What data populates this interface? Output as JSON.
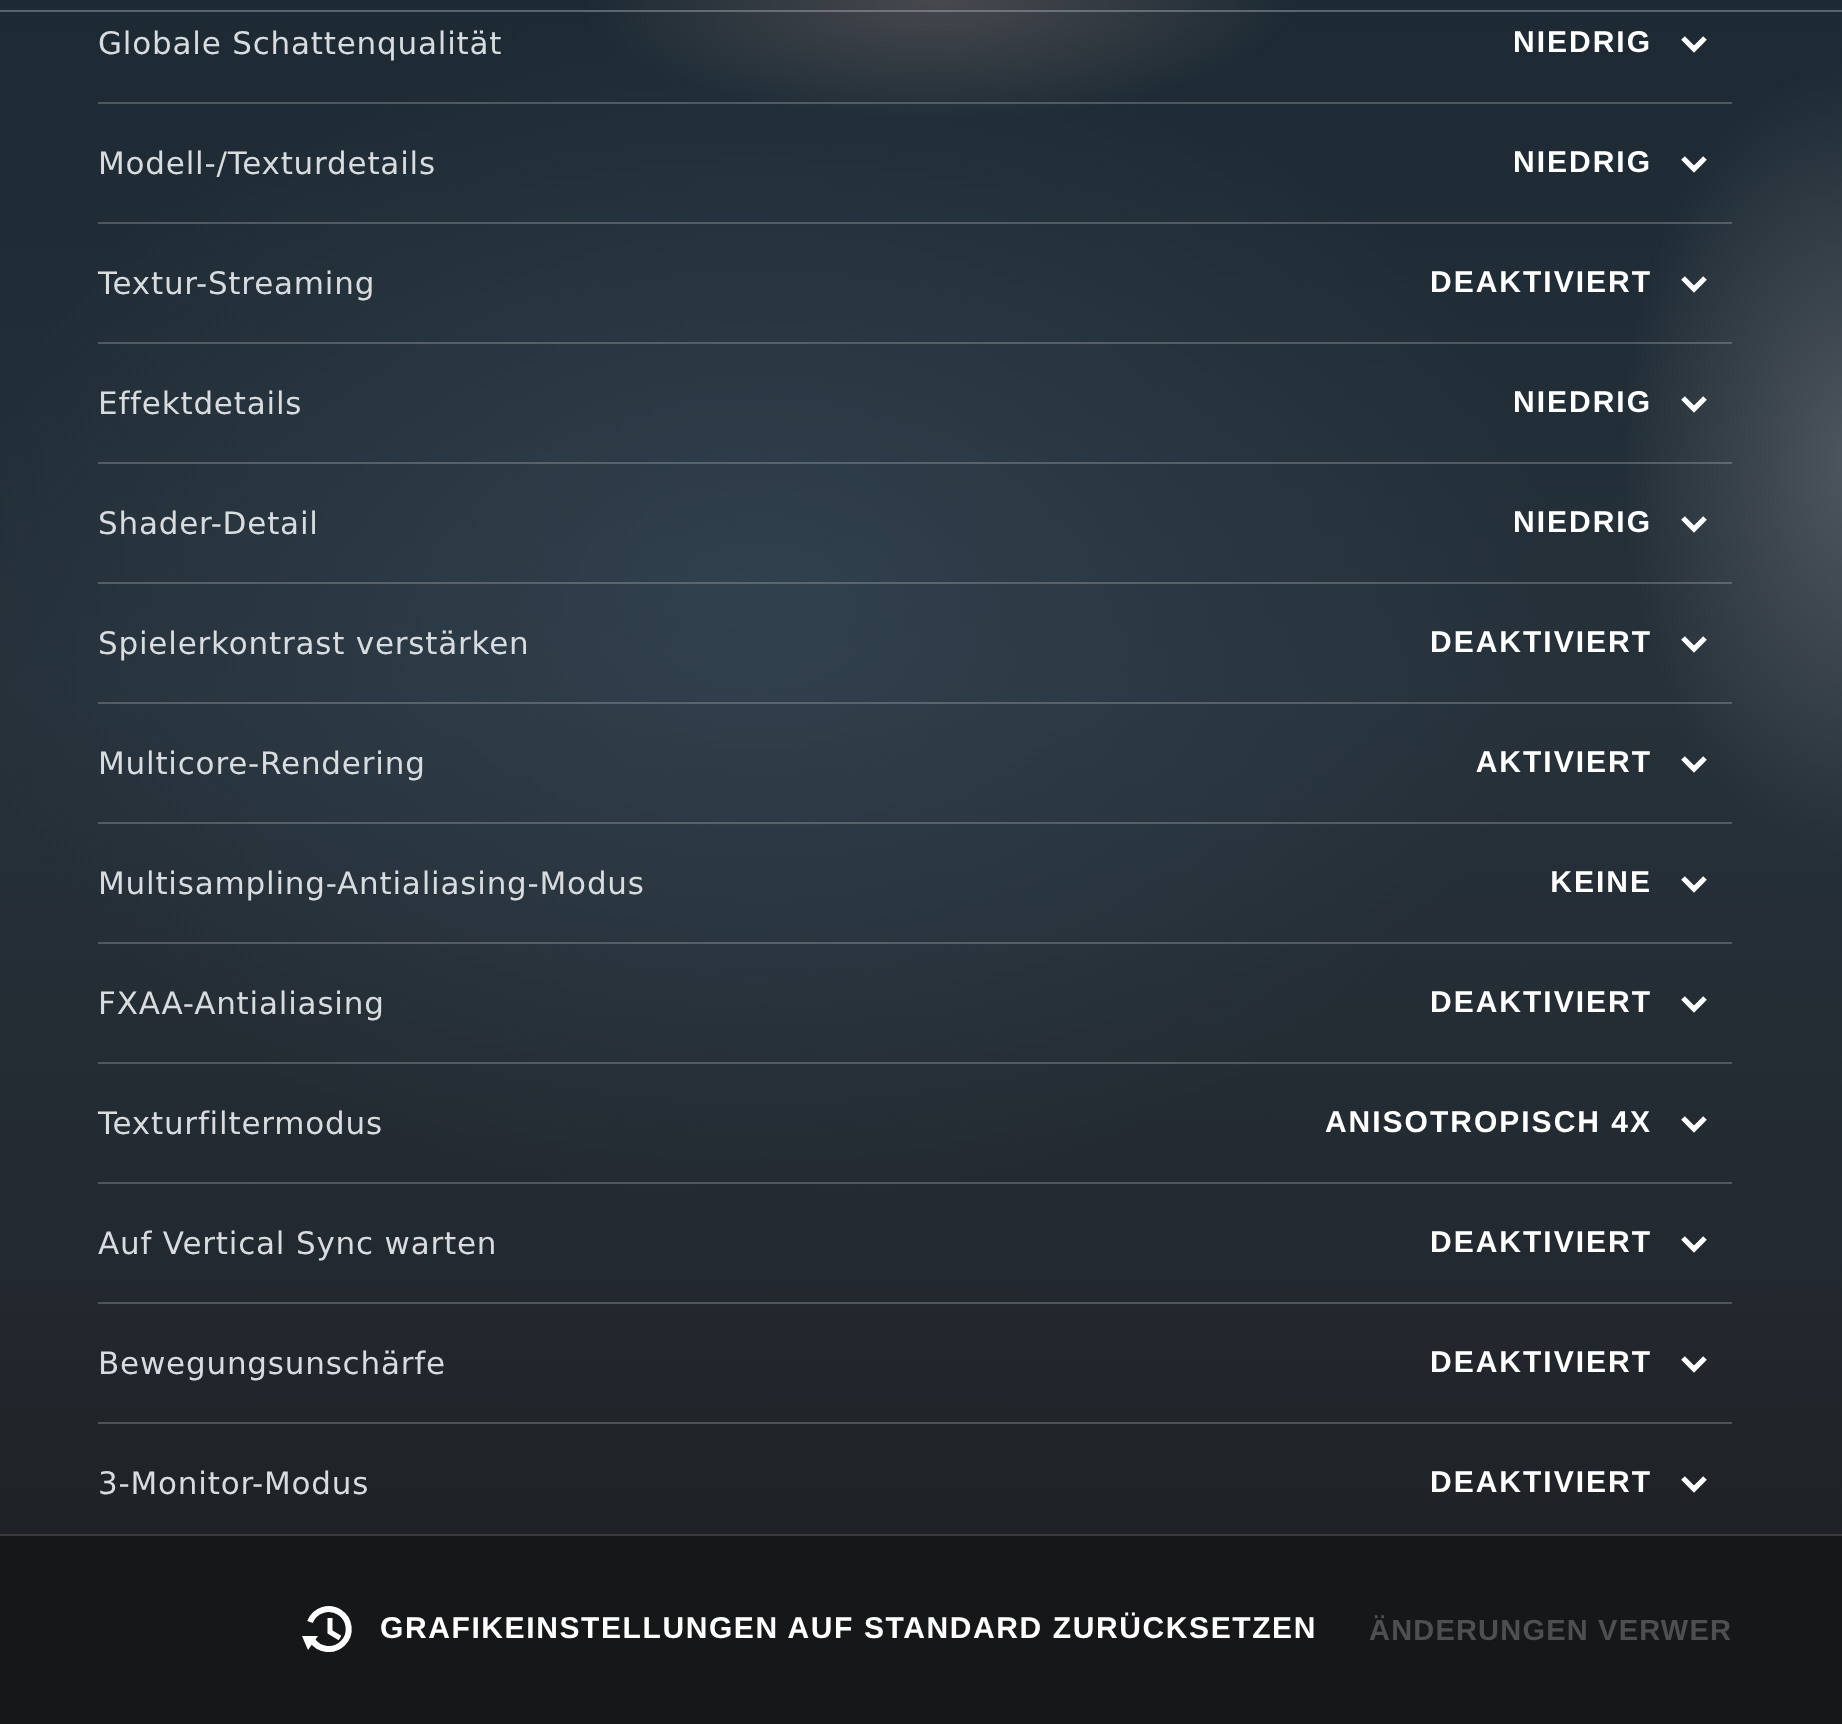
{
  "settings": [
    {
      "label": "Globale Schattenqualität",
      "value": "NIEDRIG"
    },
    {
      "label": "Modell-/Texturdetails",
      "value": "NIEDRIG"
    },
    {
      "label": "Textur-Streaming",
      "value": "DEAKTIVIERT"
    },
    {
      "label": "Effektdetails",
      "value": "NIEDRIG"
    },
    {
      "label": "Shader-Detail",
      "value": "NIEDRIG"
    },
    {
      "label": "Spielerkontrast verstärken",
      "value": "DEAKTIVIERT"
    },
    {
      "label": "Multicore-Rendering",
      "value": "AKTIVIERT"
    },
    {
      "label": "Multisampling-Antialiasing-Modus",
      "value": "KEINE"
    },
    {
      "label": "FXAA-Antialiasing",
      "value": "DEAKTIVIERT"
    },
    {
      "label": "Texturfiltermodus",
      "value": "ANISOTROPISCH 4X"
    },
    {
      "label": "Auf Vertical Sync warten",
      "value": "DEAKTIVIERT"
    },
    {
      "label": "Bewegungsunschärfe",
      "value": "DEAKTIVIERT"
    },
    {
      "label": "3-Monitor-Modus",
      "value": "DEAKTIVIERT"
    }
  ],
  "footer": {
    "reset_button": "GRAFIKEINSTELLUNGEN AUF STANDARD ZURÜCKSETZEN",
    "discard_button": {
      "label": "ÄNDERUNGEN VERWER",
      "disabled": true
    }
  }
}
